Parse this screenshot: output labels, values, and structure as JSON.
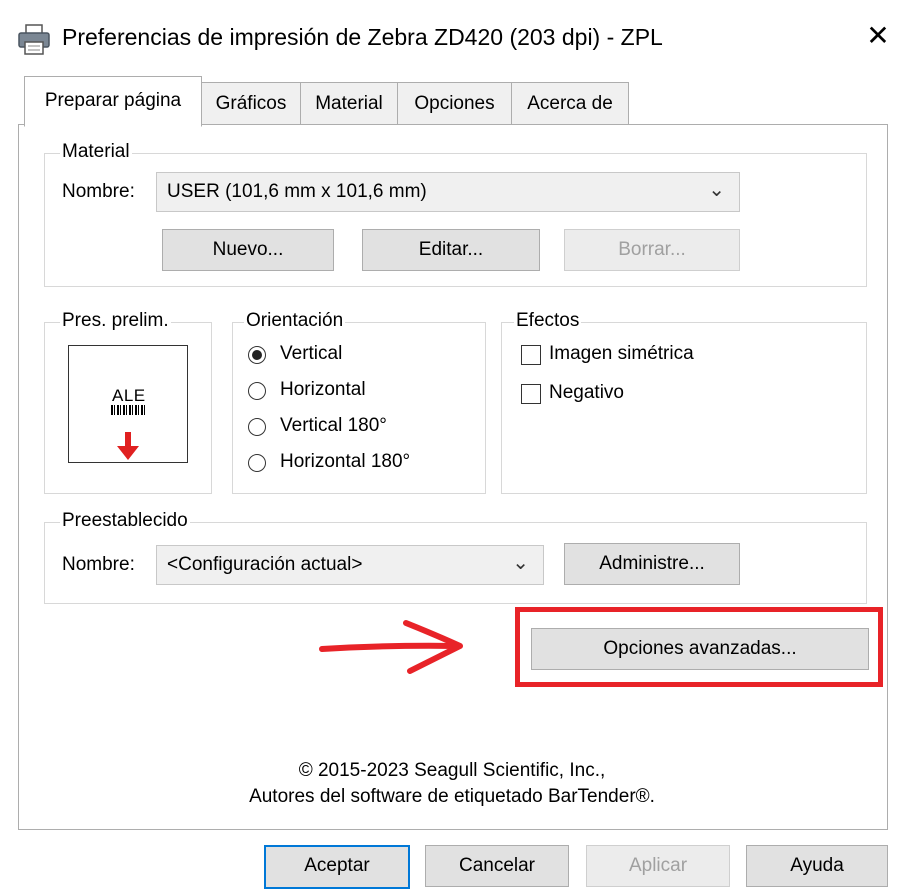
{
  "window": {
    "title": "Preferencias de impresión de Zebra ZD420 (203 dpi) - ZPL",
    "close_symbol": "✕",
    "icon": "printer-icon"
  },
  "tabs": [
    {
      "label": "Preparar página",
      "active": true
    },
    {
      "label": "Gráficos",
      "active": false
    },
    {
      "label": "Material",
      "active": false
    },
    {
      "label": "Opciones",
      "active": false
    },
    {
      "label": "Acerca de",
      "active": false
    }
  ],
  "material": {
    "legend": "Material",
    "name_label": "Nombre:",
    "selected": "USER (101,6 mm x 101,6 mm)",
    "new_label": "Nuevo...",
    "edit_label": "Editar...",
    "delete_label": "Borrar..."
  },
  "preview": {
    "legend": "Pres. prelim.",
    "sample_text": "ALE"
  },
  "orientation": {
    "legend": "Orientación",
    "options": [
      {
        "label": "Vertical",
        "checked": true
      },
      {
        "label": "Horizontal",
        "checked": false
      },
      {
        "label": "Vertical 180°",
        "checked": false
      },
      {
        "label": "Horizontal 180°",
        "checked": false
      }
    ]
  },
  "effects": {
    "legend": "Efectos",
    "options": [
      {
        "label": "Imagen simétrica",
        "checked": false
      },
      {
        "label": "Negativo",
        "checked": false
      }
    ]
  },
  "preset": {
    "legend": "Preestablecido",
    "name_label": "Nombre:",
    "selected": "<Configuración actual>",
    "manage_label": "Administre..."
  },
  "advanced": {
    "label": "Opciones avanzadas..."
  },
  "copyright": {
    "line1": "© 2015-2023 Seagull Scientific, Inc.,",
    "line2": "Autores del software de etiquetado BarTender®."
  },
  "footer": {
    "ok_label": "Aceptar",
    "cancel_label": "Cancelar",
    "apply_label": "Aplicar",
    "help_label": "Ayuda"
  },
  "colors": {
    "highlight": "#e82328",
    "accent": "#0078d7"
  }
}
